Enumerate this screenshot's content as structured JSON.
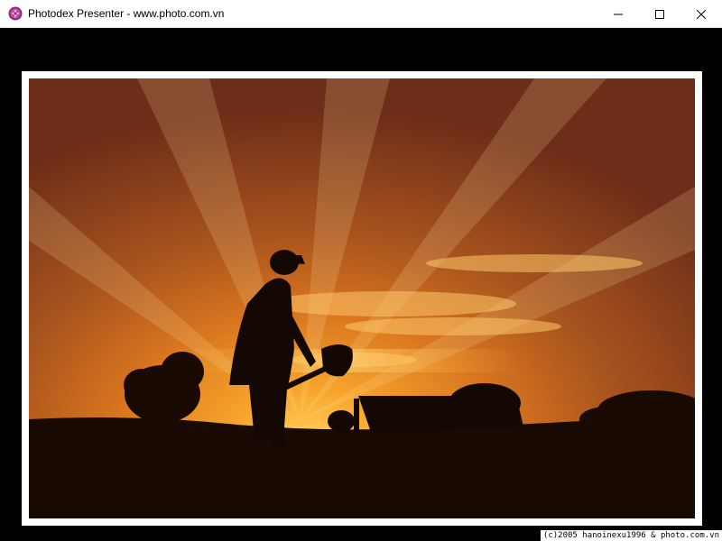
{
  "window": {
    "title": "Photodex Presenter - www.photo.com.vn",
    "app_icon": "photodex-icon",
    "controls": {
      "minimize": "minimize-icon",
      "maximize": "maximize-icon",
      "close": "close-icon"
    }
  },
  "viewer": {
    "background_color": "#000000",
    "frame_color": "#ffffff",
    "photo": {
      "subject": "silhouette-of-worker-shoveling-at-sunset"
    },
    "copyright": "(c)2005 hanoinexu1996 & photo.com.vn"
  }
}
